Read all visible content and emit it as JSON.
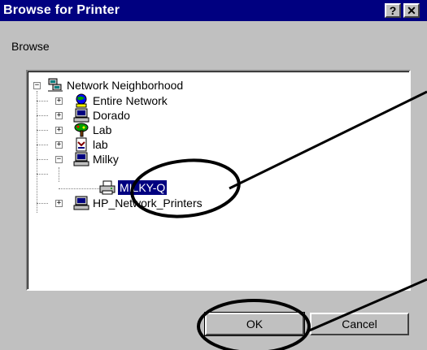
{
  "window": {
    "title": "Browse for Printer",
    "help_glyph": "?",
    "close_glyph": "✕"
  },
  "browse_label": "Browse",
  "tree": {
    "root": {
      "label": "Network Neighborhood",
      "icon": "network-neighborhood-icon",
      "state": "expanded"
    },
    "items": [
      {
        "label": "Entire Network",
        "icon": "globe-network-icon",
        "state": "collapsed"
      },
      {
        "label": "Dorado",
        "icon": "computer-icon",
        "state": "collapsed"
      },
      {
        "label": "Lab",
        "icon": "tree-icon",
        "state": "collapsed"
      },
      {
        "label": "lab",
        "icon": "document-icon",
        "state": "collapsed"
      },
      {
        "label": "Milky",
        "icon": "computer-icon",
        "state": "expanded",
        "children": [
          {
            "label": "MILKY-Q",
            "icon": "printer-icon",
            "selected": true
          }
        ]
      },
      {
        "label": "HP_Network_Printers",
        "icon": "computer-icon",
        "state": "collapsed"
      }
    ]
  },
  "buttons": {
    "ok": "OK",
    "cancel": "Cancel"
  },
  "colors": {
    "titlebar": "#000080",
    "dialog": "#c0c0c0",
    "selection": "#000080"
  }
}
